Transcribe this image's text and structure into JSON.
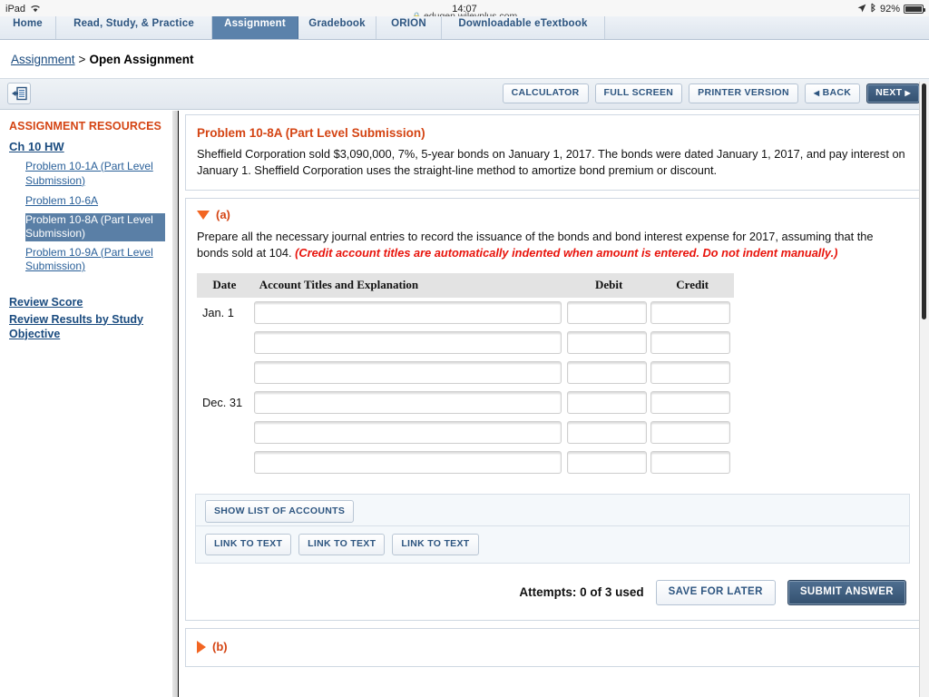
{
  "status_bar": {
    "device": "iPad",
    "wifi_icon": "wifi-icon",
    "time": "14:07",
    "location_icon": "location-arrow-icon",
    "bluetooth_icon": "bluetooth-icon",
    "battery_percent": "92%",
    "battery_icon": "battery-icon"
  },
  "browser": {
    "lock_icon": "lock-icon",
    "url": "edugen.wileyplus.com"
  },
  "tabs": [
    {
      "label": "Home",
      "active": false
    },
    {
      "label": "Read, Study, & Practice",
      "active": false
    },
    {
      "label": "Assignment",
      "active": true
    },
    {
      "label": "Gradebook",
      "active": false
    },
    {
      "label": "ORION",
      "active": false
    },
    {
      "label": "Downloadable eTextbook",
      "active": false
    }
  ],
  "breadcrumb": {
    "parent": "Assignment",
    "separator": ">",
    "current": "Open Assignment"
  },
  "toolbar": {
    "panel_toggle_icon": "collapse-panel-icon",
    "calculator": "CALCULATOR",
    "full_screen": "FULL SCREEN",
    "printer_version": "PRINTER VERSION",
    "back": "BACK",
    "back_caret": "◀",
    "next": "NEXT",
    "next_caret": "▶"
  },
  "sidebar": {
    "title": "ASSIGNMENT RESOURCES",
    "group": "Ch 10 HW",
    "items": [
      {
        "label": "Problem 10-1A (Part Level Submission)",
        "selected": false
      },
      {
        "label": "Problem 10-6A",
        "selected": false
      },
      {
        "label": "Problem 10-8A (Part Level Submission)",
        "selected": true
      },
      {
        "label": "Problem 10-9A (Part Level Submission)",
        "selected": false
      }
    ],
    "links": [
      "Review Score",
      "Review Results by Study Objective"
    ]
  },
  "problem": {
    "title": "Problem 10-8A (Part Level Submission)",
    "description": "Sheffield Corporation sold $3,090,000, 7%, 5-year bonds on January 1, 2017. The bonds were dated January 1, 2017, and pay interest on January 1. Sheffield Corporation uses the straight-line method to amortize bond premium or discount."
  },
  "part_a": {
    "marker": "(a)",
    "expanded": true,
    "instruction_plain": "Prepare all the necessary journal entries to record the issuance of the bonds and bond interest expense for 2017, assuming that the bonds sold at 104. ",
    "instruction_emphasis": "(Credit account titles are automatically indented when amount is entered. Do not indent manually.)",
    "table": {
      "columns": [
        "Date",
        "Account Titles and Explanation",
        "Debit",
        "Credit"
      ],
      "rows": [
        {
          "date": "Jan. 1",
          "account": "",
          "debit": "",
          "credit": ""
        },
        {
          "date": "",
          "account": "",
          "debit": "",
          "credit": ""
        },
        {
          "date": "",
          "account": "",
          "debit": "",
          "credit": ""
        },
        {
          "date": "Dec. 31",
          "account": "",
          "debit": "",
          "credit": ""
        },
        {
          "date": "",
          "account": "",
          "debit": "",
          "credit": ""
        },
        {
          "date": "",
          "account": "",
          "debit": "",
          "credit": ""
        }
      ]
    },
    "show_list_of_accounts": "SHOW LIST OF ACCOUNTS",
    "link_to_text": [
      "LINK TO TEXT",
      "LINK TO TEXT",
      "LINK TO TEXT"
    ],
    "attempts": "Attempts: 0 of 3 used",
    "save_for_later": "SAVE FOR LATER",
    "submit_answer": "SUBMIT ANSWER"
  },
  "part_b": {
    "marker": "(b)",
    "expanded": false
  },
  "colors": {
    "accent_orange": "#d44413",
    "link_blue": "#1a4b7f",
    "selected_blue": "#5a7fa6",
    "tab_active": "#5b82ab",
    "emphasis_red": "#e8140c",
    "dark_button": "#33506f"
  }
}
